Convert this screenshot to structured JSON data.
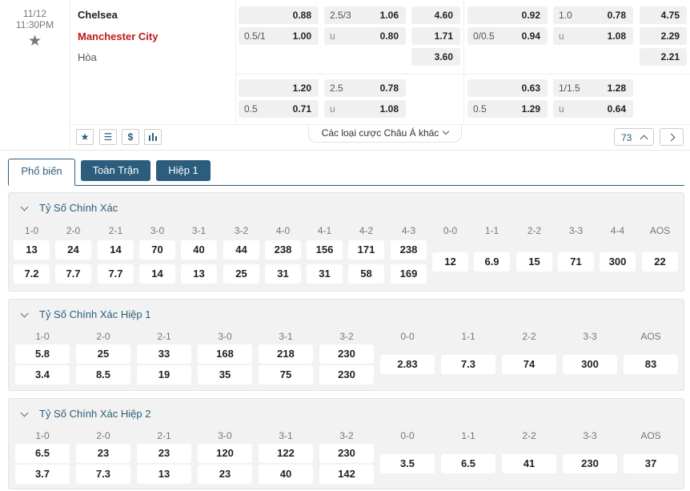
{
  "match": {
    "date": "11/12",
    "time": "11:30PM",
    "home": "Chelsea",
    "away": "Manchester City",
    "draw": "Hòa",
    "main_market": [
      {
        "handicap": "",
        "value": "0.88"
      },
      {
        "handicap": "2.5/3",
        "value": "1.06"
      },
      {
        "handicap": "",
        "value": "4.60"
      },
      {
        "handicap": "",
        "value": "0.92"
      },
      {
        "handicap": "1.0",
        "value": "0.78"
      },
      {
        "handicap": "",
        "value": "4.75"
      },
      {
        "handicap": "0.5/1",
        "value": "1.00"
      },
      {
        "handicap": "u",
        "value": "0.80"
      },
      {
        "handicap": "",
        "value": "1.71"
      },
      {
        "handicap": "0/0.5",
        "value": "0.94"
      },
      {
        "handicap": "u",
        "value": "1.08"
      },
      {
        "handicap": "",
        "value": "2.29"
      },
      {
        "handicap": "",
        "value": "3.60"
      },
      {
        "handicap": "",
        "value": "2.21"
      }
    ],
    "alt_market": [
      {
        "handicap": "",
        "value": "1.20"
      },
      {
        "handicap": "2.5",
        "value": "0.78"
      },
      {
        "handicap": "",
        "value": "0.63"
      },
      {
        "handicap": "1/1.5",
        "value": "1.28"
      },
      {
        "handicap": "0.5",
        "value": "0.71"
      },
      {
        "handicap": "u",
        "value": "1.08"
      },
      {
        "handicap": "0.5",
        "value": "1.29"
      },
      {
        "handicap": "u",
        "value": "0.64"
      }
    ],
    "toolbar_icons": [
      "star-icon",
      "list-icon",
      "dollar-icon",
      "chart-icon"
    ],
    "more_bets_label": "Các loại cược Châu Á khác",
    "more_count": "73"
  },
  "tabs": [
    "Phổ biến",
    "Toàn Trận",
    "Hiệp 1"
  ],
  "sections": [
    {
      "title": "Tỷ Số Chính Xác",
      "home_scores": [
        "1-0",
        "2-0",
        "2-1",
        "3-0",
        "3-1",
        "3-2",
        "4-0",
        "4-1",
        "4-2",
        "4-3"
      ],
      "home_odds": [
        "13",
        "24",
        "14",
        "70",
        "40",
        "44",
        "238",
        "156",
        "171",
        "238"
      ],
      "away_odds": [
        "7.2",
        "7.7",
        "7.7",
        "14",
        "13",
        "25",
        "31",
        "31",
        "58",
        "169"
      ],
      "draw_scores": [
        "0-0",
        "1-1",
        "2-2",
        "3-3",
        "4-4",
        "AOS"
      ],
      "draw_odds": [
        "12",
        "6.9",
        "15",
        "71",
        "300",
        "22"
      ]
    },
    {
      "title": "Tỷ Số Chính Xác Hiệp 1",
      "home_scores": [
        "1-0",
        "2-0",
        "2-1",
        "3-0",
        "3-1",
        "3-2"
      ],
      "home_odds": [
        "5.8",
        "25",
        "33",
        "168",
        "218",
        "230"
      ],
      "away_odds": [
        "3.4",
        "8.5",
        "19",
        "35",
        "75",
        "230"
      ],
      "draw_scores": [
        "0-0",
        "1-1",
        "2-2",
        "3-3",
        "AOS"
      ],
      "draw_odds": [
        "2.83",
        "7.3",
        "74",
        "300",
        "83"
      ]
    },
    {
      "title": "Tỷ Số Chính Xác Hiệp 2",
      "home_scores": [
        "1-0",
        "2-0",
        "2-1",
        "3-0",
        "3-1",
        "3-2"
      ],
      "home_odds": [
        "6.5",
        "23",
        "23",
        "120",
        "122",
        "230"
      ],
      "away_odds": [
        "3.7",
        "7.3",
        "13",
        "23",
        "40",
        "142"
      ],
      "draw_scores": [
        "0-0",
        "1-1",
        "2-2",
        "3-3",
        "AOS"
      ],
      "draw_odds": [
        "3.5",
        "6.5",
        "41",
        "230",
        "37"
      ]
    }
  ],
  "colors": {
    "accent": "#2c5d7c",
    "away_team": "#c0161b",
    "cell_bg": "#f0f0f0"
  }
}
